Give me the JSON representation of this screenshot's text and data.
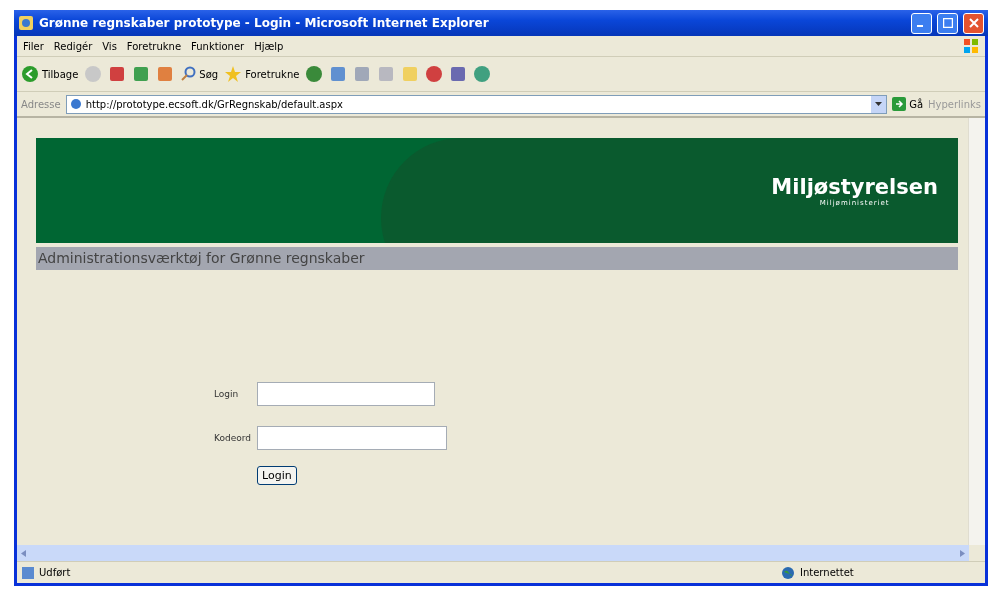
{
  "window": {
    "title": "Grønne regnskaber prototype - Login - Microsoft Internet Explorer"
  },
  "menu": [
    "Filer",
    "Redigér",
    "Vis",
    "Foretrukne",
    "Funktioner",
    "Hjælp"
  ],
  "toolbar": {
    "back": "Tilbage",
    "search": "Søg",
    "favorites": "Foretrukne"
  },
  "address_bar": {
    "label": "Adresse",
    "url": "http://prototype.ecsoft.dk/GrRegnskab/default.aspx",
    "go": "Gå",
    "links": "Hyperlinks"
  },
  "banner": {
    "logo_title": "Miljøstyrelsen",
    "logo_subtitle": "Miljøministeriet",
    "heading": "Administrationsværktøj for Grønne regnskaber"
  },
  "form": {
    "fields": [
      {
        "label": "Login",
        "kind": "text"
      },
      {
        "label": "Kodeord",
        "kind": "password"
      }
    ],
    "submit": "Login"
  },
  "status_bar": {
    "status": "Udført",
    "zone": "Internettet"
  }
}
